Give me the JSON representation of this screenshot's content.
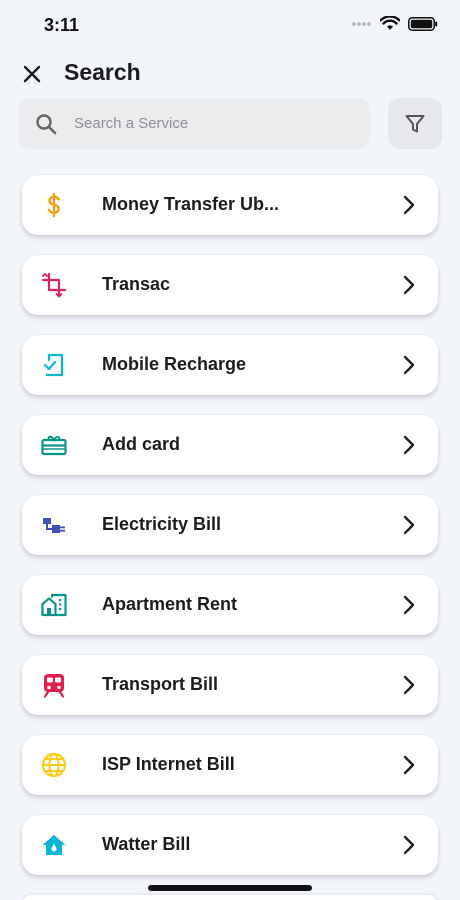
{
  "status_bar": {
    "time": "3:11"
  },
  "header": {
    "title": "Search",
    "close_icon": "close-icon"
  },
  "search": {
    "placeholder": "Search a Service",
    "value": ""
  },
  "filter": {
    "icon": "filter-icon"
  },
  "services": [
    {
      "label": "Money Transfer Ub...",
      "icon": "dollar-icon",
      "color": "#f59e0b"
    },
    {
      "label": "Transac",
      "icon": "crop-icon",
      "color": "#e11d63"
    },
    {
      "label": "Mobile Recharge",
      "icon": "mobile-check-icon",
      "color": "#06b6d4"
    },
    {
      "label": "Add card",
      "icon": "gift-card-icon",
      "color": "#0d9488"
    },
    {
      "label": "Electricity Bill",
      "icon": "plug-icon",
      "color": "#3f51b5"
    },
    {
      "label": "Apartment Rent",
      "icon": "apartment-icon",
      "color": "#0d9488"
    },
    {
      "label": "Transport Bill",
      "icon": "train-icon",
      "color": "#e11d48"
    },
    {
      "label": "ISP Internet Bill",
      "icon": "globe-icon",
      "color": "#facc15"
    },
    {
      "label": "Watter Bill",
      "icon": "water-house-icon",
      "color": "#06b6d4"
    }
  ]
}
